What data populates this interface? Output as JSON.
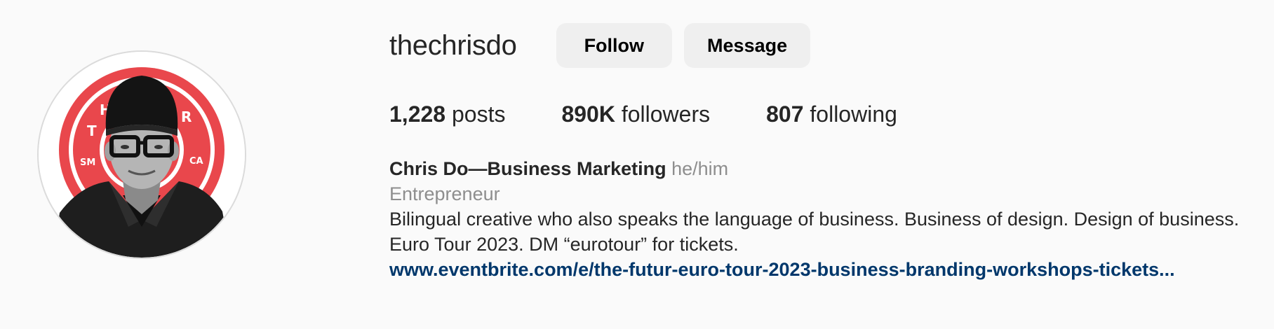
{
  "profile": {
    "username": "thechrisdo",
    "follow_label": "Follow",
    "message_label": "Message",
    "stats": {
      "posts_count": "1,228",
      "posts_label": "posts",
      "followers_count": "890K",
      "followers_label": "followers",
      "following_count": "807",
      "following_label": "following"
    },
    "bio": {
      "full_name": "Chris Do—Business Marketing",
      "pronouns": "he/him",
      "category": "Entrepreneur",
      "description": "Bilingual creative who also speaks the language of business. Business of design. Design of business. Euro Tour 2023. DM “eurotour” for tickets.",
      "link": "www.eventbrite.com/e/the-futur-euro-tour-2023-business-branding-workshops-tickets..."
    }
  },
  "colors": {
    "background": "#fafafa",
    "button_bg": "#efefef",
    "link": "#00376b",
    "secondary_text": "#8e8e8e",
    "badge_red": "#e9474c"
  },
  "icons": {
    "avatar": "profile-photo"
  }
}
